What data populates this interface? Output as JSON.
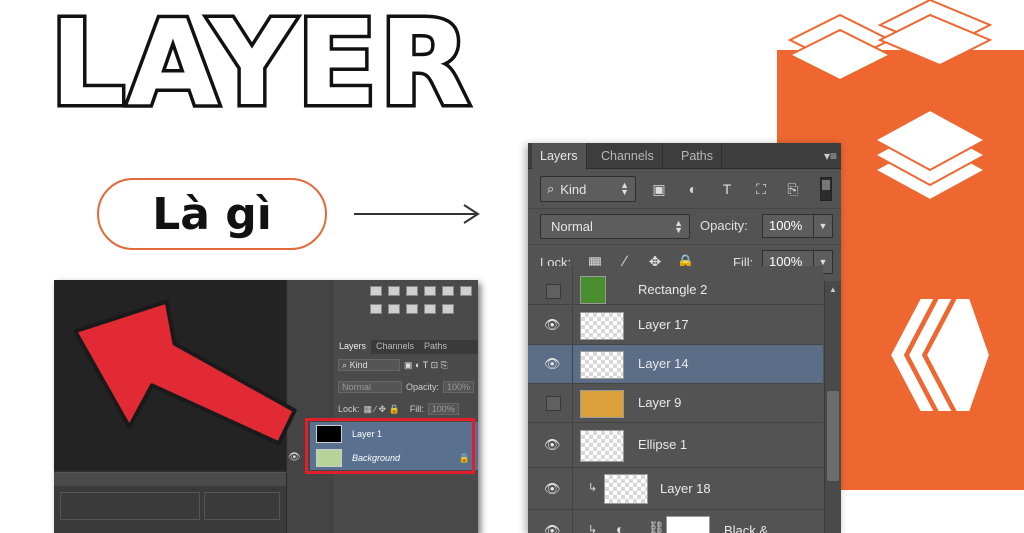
{
  "header": {
    "title": "LAYER",
    "subtitle": "Là gì"
  },
  "colors": {
    "accent": "#ee6731",
    "highlight": "#e01f2a",
    "selected_layer": "#5b6d87"
  },
  "small_panel": {
    "tabs": [
      "Layers",
      "Channels",
      "Paths"
    ],
    "kind_label": "Kind",
    "blend_mode": "Normal",
    "opacity_label": "Opacity:",
    "opacity_value": "100%",
    "lock_label": "Lock:",
    "fill_label": "Fill:",
    "fill_value": "100%",
    "layers": [
      {
        "name": "Layer 1"
      },
      {
        "name": "Background"
      }
    ]
  },
  "layers_panel": {
    "tabs": [
      "Layers",
      "Channels",
      "Paths"
    ],
    "kind_label": "Kind",
    "blend_mode": "Normal",
    "opacity_label": "Opacity:",
    "opacity_value": "100%",
    "lock_label": "Lock:",
    "fill_label": "Fill:",
    "fill_value": "100%",
    "layers": [
      {
        "name": "Rectangle 2",
        "visible": false,
        "selected": false
      },
      {
        "name": "Layer 17",
        "visible": true,
        "selected": false
      },
      {
        "name": "Layer 14",
        "visible": true,
        "selected": true
      },
      {
        "name": "Layer 9",
        "visible": false,
        "selected": false
      },
      {
        "name": "Ellipse 1",
        "visible": true,
        "selected": false
      },
      {
        "name": "Layer 18",
        "visible": true,
        "selected": false
      },
      {
        "name": "Black &",
        "visible": true,
        "selected": false
      }
    ]
  },
  "icons": [
    "eye-icon",
    "search-icon",
    "lock-icon",
    "brush-icon",
    "move-icon",
    "link-icon",
    "panel-menu-icon"
  ]
}
